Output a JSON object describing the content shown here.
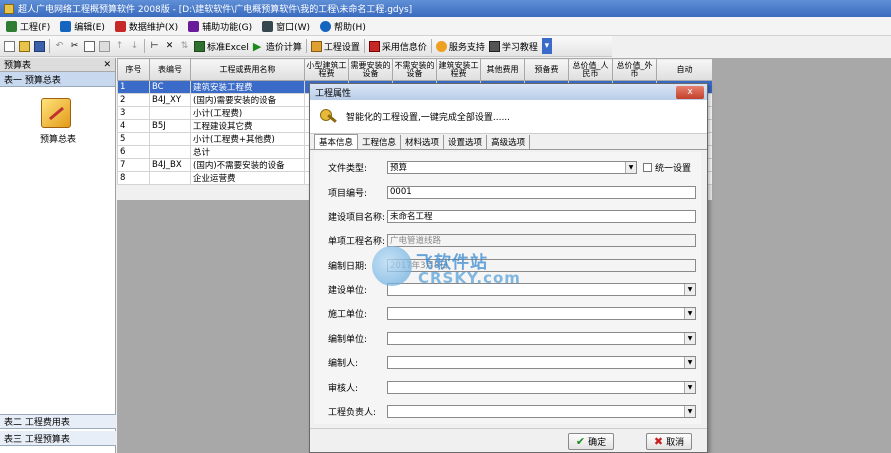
{
  "window": {
    "title": "超人广电网络工程概预算软件 2008版 - [D:\\建软软件\\广电概预算软件\\我的工程\\未命名工程.gdys]"
  },
  "menu": [
    {
      "label": "工程(F)",
      "icon": "project-icon",
      "color": "#2e7d32"
    },
    {
      "label": "编辑(E)",
      "icon": "edit-icon",
      "color": "#1565c0"
    },
    {
      "label": "数据维护(X)",
      "icon": "data-icon",
      "color": "#c62828"
    },
    {
      "label": "辅助功能(G)",
      "icon": "tools-icon",
      "color": "#6a1b9a"
    },
    {
      "label": "窗口(W)",
      "icon": "window-icon",
      "color": "#37474f"
    },
    {
      "label": "帮助(H)",
      "icon": "help-icon",
      "color": "#1565c0"
    }
  ],
  "toolbar": {
    "excel_label": "标准Excel",
    "calc_label": "造价计算",
    "settings_label": "工程设置",
    "price_label": "采用信息价",
    "support_label": "服务支持",
    "tutorial_label": "学习教程"
  },
  "leftpanel": {
    "header": "预算表",
    "close": "✕",
    "tab_top": "表一 预算总表",
    "icon_label": "预算总表",
    "tab_bottom1": "表二 工程费用表",
    "tab_bottom2": "表三 工程预算表"
  },
  "grid": {
    "headers": [
      "序号",
      "表编号",
      "工程或费用名称",
      "小型建筑工程费",
      "需要安装的设备",
      "不需安装的设备",
      "建筑安装工程费",
      "其他费用",
      "预备费",
      "总价值_人民币",
      "总价值_外币",
      "自动"
    ],
    "rows": [
      [
        "1",
        "BC",
        "建筑安装工程费"
      ],
      [
        "2",
        "B4J_XY",
        "(国内)需要安装的设备"
      ],
      [
        "3",
        "",
        "小计(工程费)"
      ],
      [
        "4",
        "B5J",
        "工程建设其它费"
      ],
      [
        "5",
        "",
        "小计(工程费+其他费)"
      ],
      [
        "6",
        "",
        "总计"
      ],
      [
        "7",
        "B4J_BX",
        "(国内)不需要安装的设备"
      ],
      [
        "8",
        "",
        "企业运营费"
      ]
    ]
  },
  "dialog": {
    "title": "工程属性",
    "close": "x",
    "banner": "智能化的工程设置,一键完成全部设置......",
    "tabs": [
      "基本信息",
      "工程信息",
      "材料选项",
      "设置选项",
      "高级选项"
    ],
    "fields": {
      "file_type_label": "文件类型:",
      "file_type_value": "预算",
      "unify_label": "统一设置",
      "project_no_label": "项目编号:",
      "project_no_value": "0001",
      "build_name_label": "建设项目名称:",
      "build_name_value": "未命名工程",
      "unit_name_label": "单项工程名称:",
      "unit_name_value": "广电管道线路",
      "date_label": "编制日期:",
      "date_value": "2017年3月8日",
      "build_unit_label": "建设单位:",
      "build_unit_value": "",
      "construct_unit_label": "施工单位:",
      "construct_unit_value": "",
      "prepare_unit_label": "编制单位:",
      "prepare_unit_value": "",
      "preparer_label": "编制人:",
      "preparer_value": "",
      "reviewer_label": "审核人:",
      "reviewer_value": "",
      "manager_label": "工程负责人:",
      "manager_value": ""
    },
    "ok_label": "确定",
    "cancel_label": "取消"
  },
  "watermark": {
    "line1": "飞软件站",
    "line2": "CRSKY.com"
  }
}
